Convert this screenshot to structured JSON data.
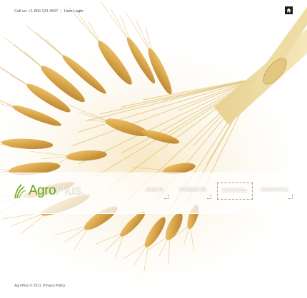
{
  "topbar": {
    "phone": "Call us: +1 800 123 4567",
    "separator": "|",
    "login": "User Login"
  },
  "home_icon": "home-icon",
  "logo": {
    "brand_part1": "Agro",
    "brand_part2": "Plus.",
    "mark_icon": "wheat-leaf-icon",
    "accent_color": "#64a51e"
  },
  "nav": {
    "items": [
      {
        "label": "ABOUT."
      },
      {
        "label": "PRODUCTS."
      },
      {
        "label": "SERVICES."
      },
      {
        "label": "CONTACTS."
      }
    ],
    "active_index": 2
  },
  "footer": {
    "copyright": "AgroPlus © 2011.",
    "privacy": "Privacy Policy"
  },
  "background": {
    "image": "bundle of golden wheat ears on white",
    "wheat_color": "#d9a441"
  }
}
